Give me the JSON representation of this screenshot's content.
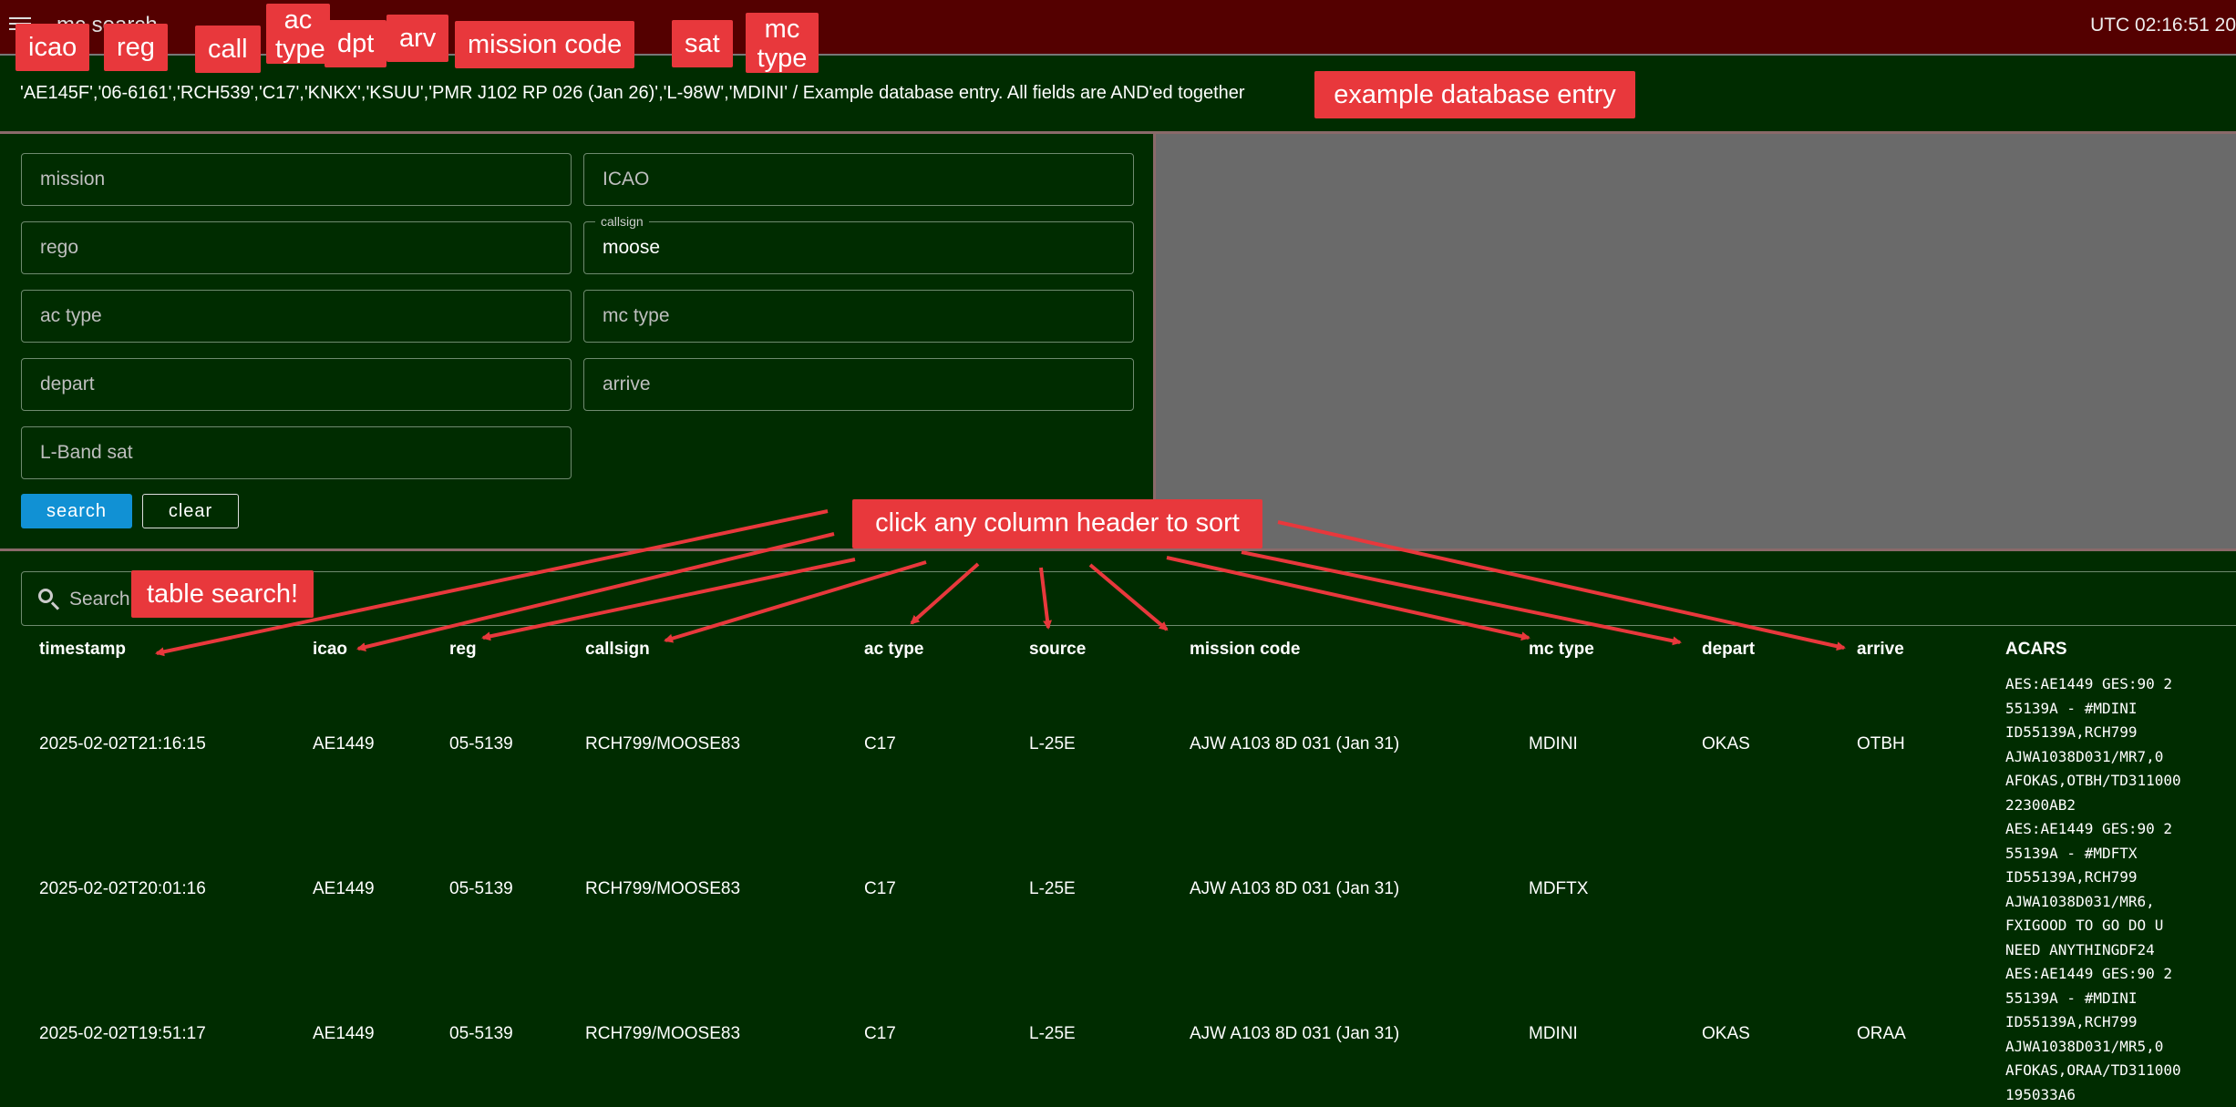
{
  "header": {
    "app_title": "mc search",
    "utc_time": "UTC 02:16:51 20"
  },
  "example": {
    "text": "'AE145F','06-6161','RCH539','C17','KNKX','KSUU','PMR J102 RP 026 (Jan 26)','L-98W','MDINI' / Example database entry. All fields are AND'ed together"
  },
  "form": {
    "mission_placeholder": "mission",
    "icao_placeholder": "ICAO",
    "rego_placeholder": "rego",
    "callsign_label": "callsign",
    "callsign_value": "moose",
    "actype_placeholder": "ac type",
    "mctype_placeholder": "mc type",
    "depart_placeholder": "depart",
    "arrive_placeholder": "arrive",
    "lband_placeholder": "L-Band sat",
    "search_label": "search",
    "clear_label": "clear"
  },
  "table": {
    "search_placeholder": "Search",
    "headers": [
      "timestamp",
      "icao",
      "reg",
      "callsign",
      "ac type",
      "source",
      "mission code",
      "mc type",
      "depart",
      "arrive",
      "ACARS"
    ],
    "rows": [
      {
        "timestamp": "2025-02-02T21:16:15",
        "icao": "AE1449",
        "reg": "05-5139",
        "callsign": "RCH799/MOOSE83",
        "actype": "C17",
        "source": "L-25E",
        "mission": "AJW A103 8D 031 (Jan 31)",
        "mctype": "MDINI",
        "depart": "OKAS",
        "arrive": "OTBH",
        "acars": "AES:AE1449 GES:90 2\n55139A - #MDINI\nID55139A,RCH799\nAJWA1038D031/MR7,0\nAFOKAS,OTBH/TD311000\n22300AB2"
      },
      {
        "timestamp": "2025-02-02T20:01:16",
        "icao": "AE1449",
        "reg": "05-5139",
        "callsign": "RCH799/MOOSE83",
        "actype": "C17",
        "source": "L-25E",
        "mission": "AJW A103 8D 031 (Jan 31)",
        "mctype": "MDFTX",
        "depart": "",
        "arrive": "",
        "acars": "AES:AE1449 GES:90 2\n55139A - #MDFTX\nID55139A,RCH799\nAJWA1038D031/MR6,\nFXIGOOD TO GO DO U\nNEED ANYTHINGDF24"
      },
      {
        "timestamp": "2025-02-02T19:51:17",
        "icao": "AE1449",
        "reg": "05-5139",
        "callsign": "RCH799/MOOSE83",
        "actype": "C17",
        "source": "L-25E",
        "mission": "AJW A103 8D 031 (Jan 31)",
        "mctype": "MDINI",
        "depart": "OKAS",
        "arrive": "ORAA",
        "acars": "AES:AE1449 GES:90 2\n55139A - #MDINI\nID55139A,RCH799\nAJWA1038D031/MR5,0\nAFOKAS,ORAA/TD311000\n195033A6"
      }
    ]
  },
  "annotations": {
    "icao": "icao",
    "reg": "reg",
    "call": "call",
    "ac_type": "ac type",
    "dpt": "dpt",
    "arv": "arv",
    "mission_code": "mission code",
    "sat": "sat",
    "mc_type": "mc type",
    "example_entry": "example database entry",
    "sort_hint": "click any column header to sort",
    "table_search": "table search!"
  },
  "colors": {
    "header_bg": "#540000",
    "page_bg": "#002c00",
    "search_button": "#1191d4",
    "annotation": "#e8383c",
    "grey_pane": "#6a6a6a"
  }
}
